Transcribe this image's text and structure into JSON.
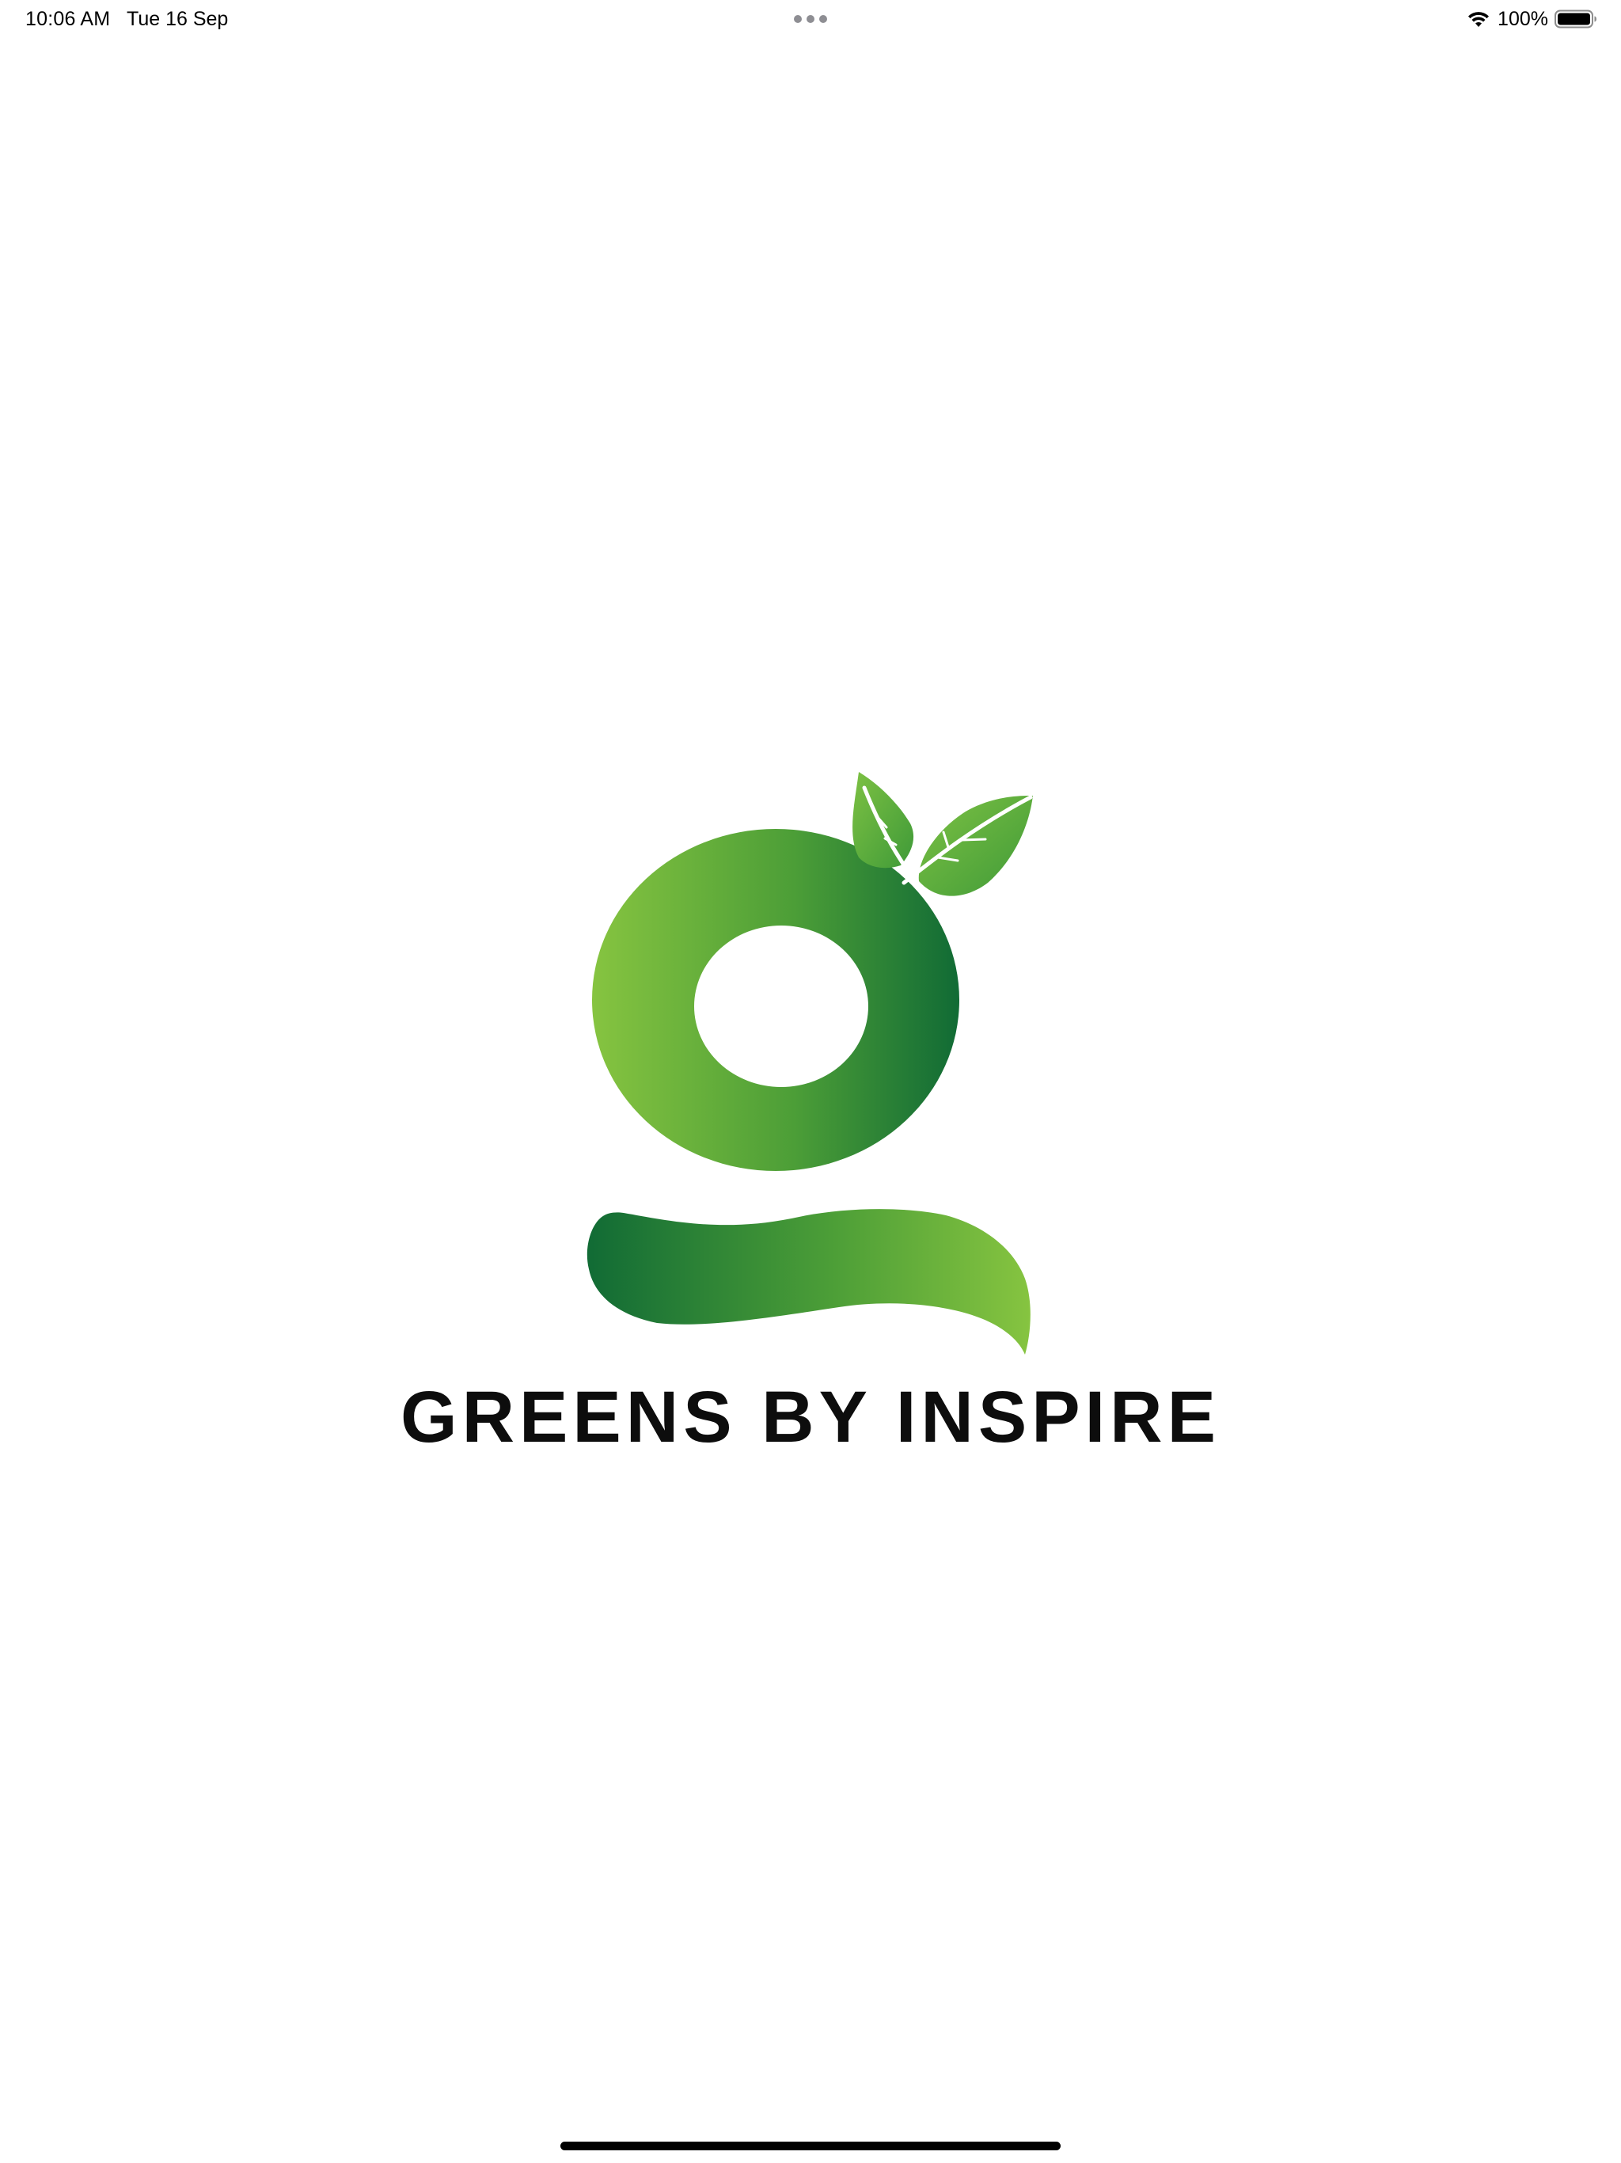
{
  "status_bar": {
    "time": "10:06 AM",
    "date": "Tue 16 Sep",
    "battery_percent": "100%",
    "battery_level": 1.0,
    "icons": [
      "multitask-dots-icon",
      "wifi-icon",
      "battery-icon"
    ]
  },
  "splash": {
    "brand_name": "GREENS BY INSPIRE",
    "logo_icon": "leaf-g-logo-icon",
    "colors": {
      "light_green": "#86C440",
      "dark_green": "#116B35",
      "leaf_green": "#5FB236"
    }
  }
}
